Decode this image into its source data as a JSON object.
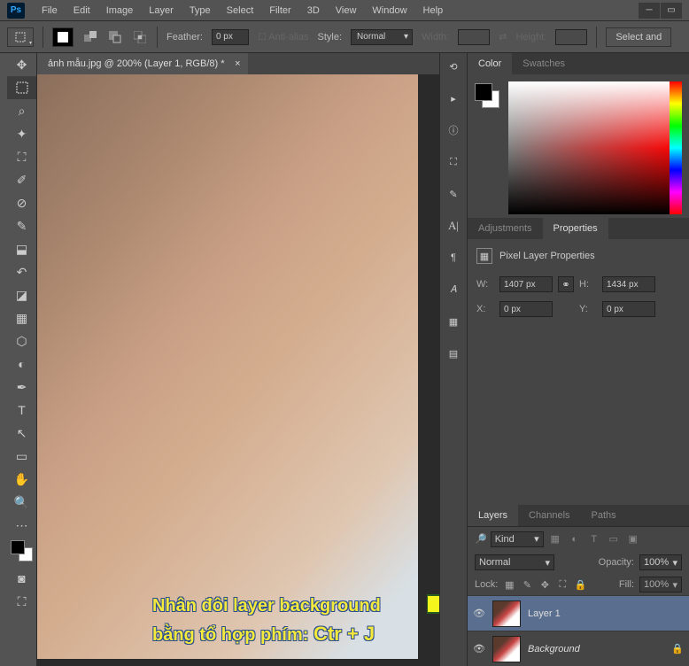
{
  "menubar": [
    "File",
    "Edit",
    "Image",
    "Layer",
    "Type",
    "Select",
    "Filter",
    "3D",
    "View",
    "Window",
    "Help"
  ],
  "optionbar": {
    "feather_label": "Feather:",
    "feather_value": "0 px",
    "antialias": "Anti-alias",
    "style_label": "Style:",
    "style_value": "Normal",
    "width_label": "Width:",
    "height_label": "Height:",
    "select_and": "Select and"
  },
  "doctab": {
    "title": "ảnh mẫu.jpg @ 200% (Layer 1, RGB/8) *"
  },
  "annotation": {
    "line1": "Nhân đôi layer background",
    "line2a": "bằng tổ hợp phím: ",
    "line2b": "Ctr + J"
  },
  "panel_color": {
    "tab1": "Color",
    "tab2": "Swatches"
  },
  "panel_adjust": {
    "tab1": "Adjustments",
    "tab2": "Properties",
    "title": "Pixel Layer Properties"
  },
  "props": {
    "w_label": "W:",
    "w": "1407 px",
    "h_label": "H:",
    "h": "1434 px",
    "x_label": "X:",
    "x": "0 px",
    "y_label": "Y:",
    "y": "0 px"
  },
  "panel_layers": {
    "tab1": "Layers",
    "tab2": "Channels",
    "tab3": "Paths",
    "kind": "Kind",
    "blend": "Normal",
    "opacity_label": "Opacity:",
    "opacity": "100%",
    "lock_label": "Lock:",
    "fill_label": "Fill:",
    "fill": "100%",
    "layer1": "Layer 1",
    "layer_bg": "Background"
  }
}
